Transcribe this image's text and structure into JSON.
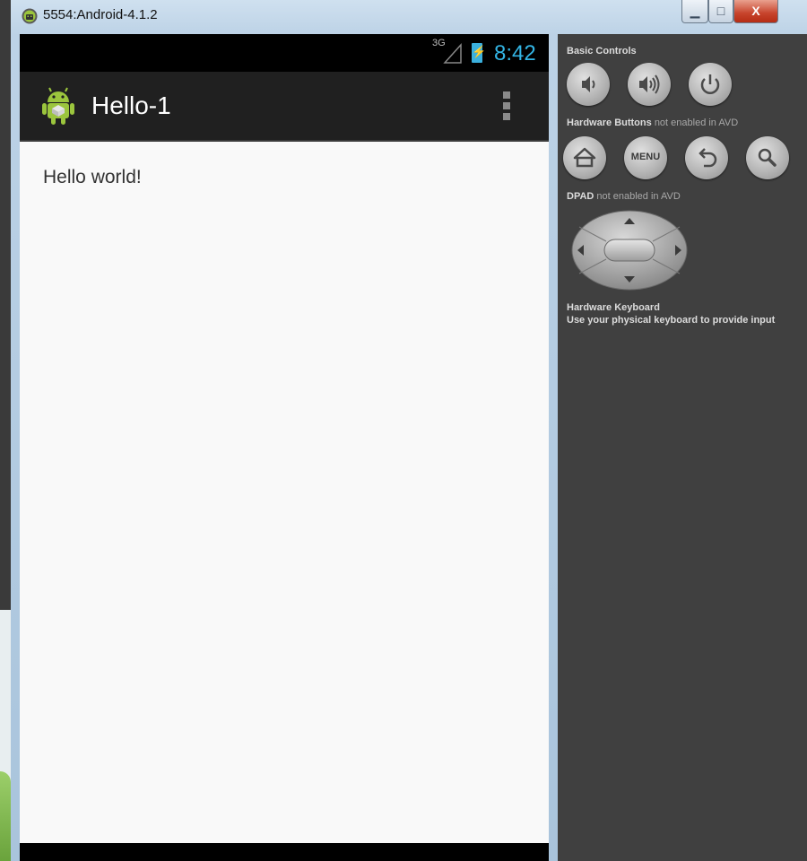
{
  "window": {
    "title": "5554:Android-4.1.2",
    "controls": {
      "minimize": "▁",
      "maximize": "□",
      "close": "X"
    }
  },
  "status_bar": {
    "network": "3G",
    "time": "8:42"
  },
  "action_bar": {
    "title": "Hello-1",
    "overflow_icon": "overflow-menu-icon"
  },
  "content": {
    "text": "Hello world!"
  },
  "panel": {
    "basic_controls_label": "Basic Controls",
    "basic_controls": [
      {
        "name": "volume-down",
        "icon": "volume-down-icon"
      },
      {
        "name": "volume-up",
        "icon": "volume-up-icon"
      },
      {
        "name": "power",
        "icon": "power-icon"
      }
    ],
    "hardware_buttons_label": "Hardware Buttons",
    "hardware_buttons_note": "not enabled in AVD",
    "hardware_buttons": [
      {
        "name": "home",
        "icon": "home-icon"
      },
      {
        "name": "menu",
        "label": "MENU"
      },
      {
        "name": "back",
        "icon": "back-icon"
      },
      {
        "name": "search",
        "icon": "search-icon"
      }
    ],
    "dpad_label": "DPAD",
    "dpad_note": "not enabled in AVD",
    "keyboard_label": "Hardware Keyboard",
    "keyboard_note": "Use your physical keyboard to provide input"
  }
}
